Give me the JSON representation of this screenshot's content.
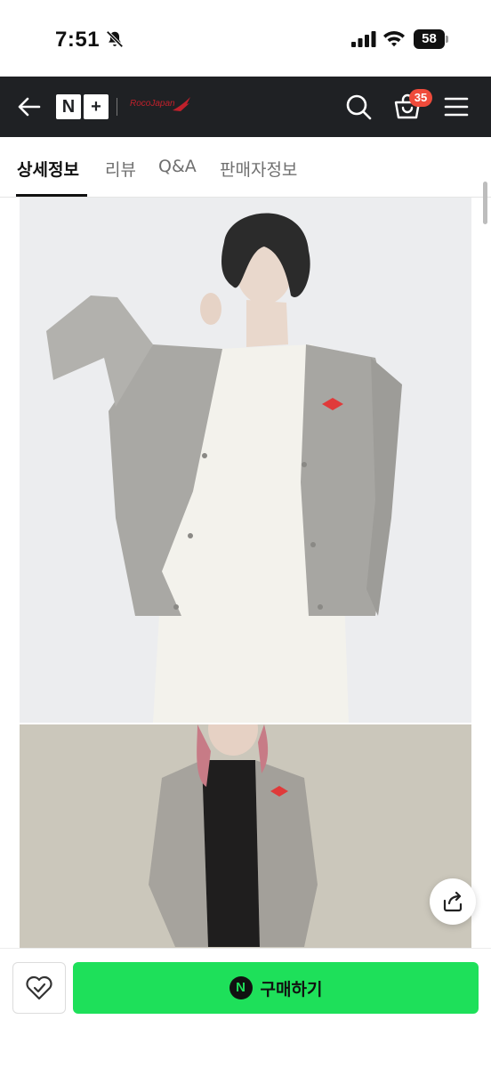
{
  "status_bar": {
    "time": "7:51",
    "battery": "58"
  },
  "header": {
    "logo_left": "N",
    "logo_right": "+",
    "brand": "RocoJapan",
    "cart_count": "35"
  },
  "tabs": [
    {
      "label": "상세정보"
    },
    {
      "label": "리뷰"
    },
    {
      "label": "Q&A"
    },
    {
      "label": "판매자정보"
    }
  ],
  "bottom_bar": {
    "npay_symbol": "N",
    "buy_label": "구매하기"
  },
  "colors": {
    "header_bg": "#1f2124",
    "badge": "#ef4b3b",
    "buy_button": "#1ee05a"
  },
  "icons": [
    "bell-slash-icon",
    "signal-icon",
    "wifi-icon",
    "back-arrow-icon",
    "search-icon",
    "cart-icon",
    "menu-icon",
    "share-icon",
    "heart-icon"
  ]
}
